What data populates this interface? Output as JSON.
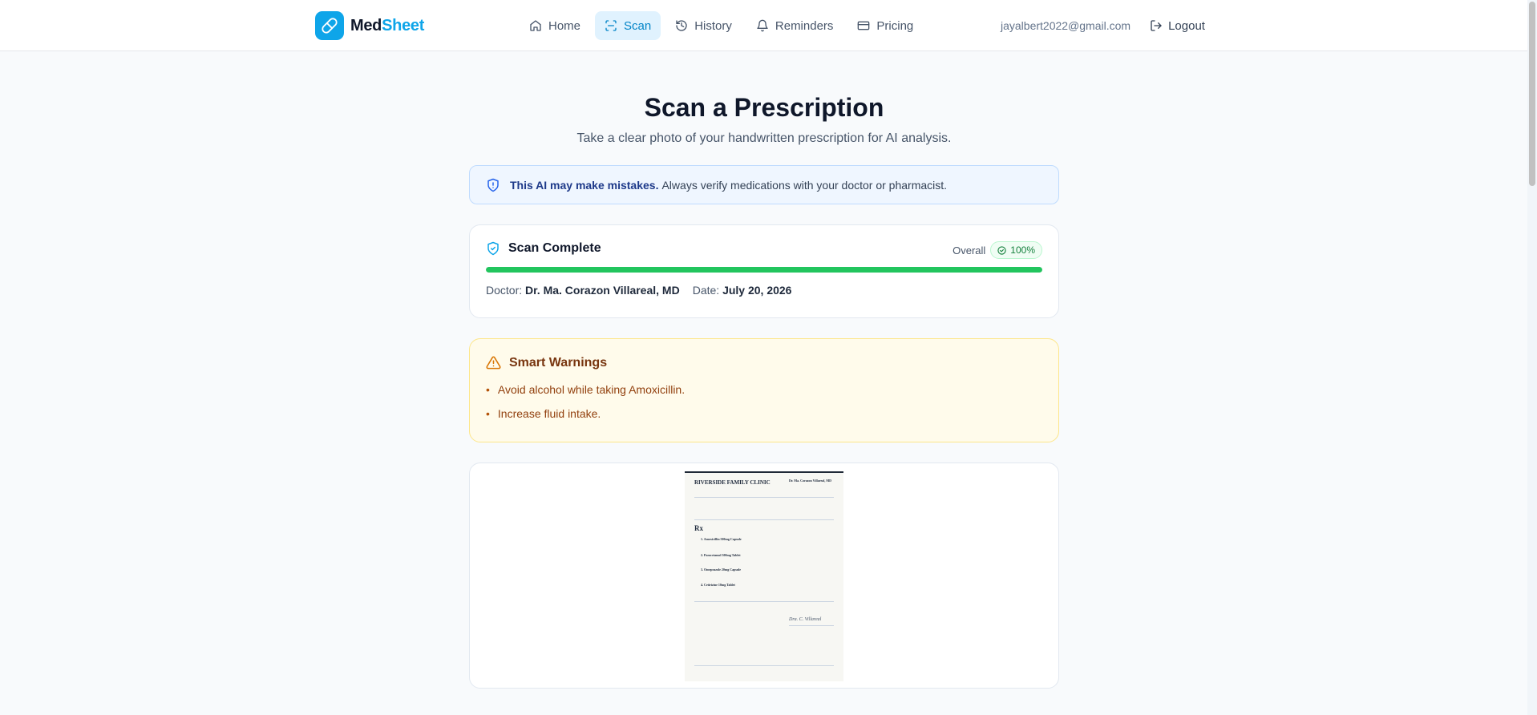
{
  "brand": {
    "name_part1": "Med",
    "name_part2": "Sheet",
    "accent": "#0ea5e9"
  },
  "nav": {
    "home": "Home",
    "scan": "Scan",
    "history": "History",
    "reminders": "Reminders",
    "pricing": "Pricing",
    "active": "Scan"
  },
  "user": {
    "email": "jayalbert2022@gmail.com",
    "logout_label": "Logout"
  },
  "page": {
    "title": "Scan a Prescription",
    "subtitle": "Take a clear photo of your handwritten prescription for AI analysis."
  },
  "notice": {
    "bold": "This AI may make mistakes.",
    "text": "Always verify medications with your doctor or pharmacist."
  },
  "scan_result": {
    "title": "Scan Complete",
    "overall_label": "Overall",
    "confidence": "100%",
    "progress_fraction": 1.0,
    "doctor_label": "Doctor:",
    "doctor": "Dr. Ma. Corazon Villareal, MD",
    "date_label": "Date:",
    "date": "July 20, 2026"
  },
  "warnings": {
    "title": "Smart Warnings",
    "items": [
      "Avoid alcohol while taking Amoxicillin.",
      "Increase fluid intake."
    ]
  },
  "prescription_image": {
    "clinic": "RIVERSIDE FAMILY CLINIC",
    "doctor": "Dr. Ma. Corazon Villareal, MD",
    "rx": "Rx",
    "meds": [
      "1. Amoxicillin 500mg Capsule",
      "2. Paracetamol 500mg Tablet",
      "3. Omeprazole 20mg Capsule",
      "4. Cetirizine 10mg Tablet"
    ],
    "signature": "Dra. C. Villareal"
  },
  "colors": {
    "success": "#22c55e",
    "warning_bg": "#fffbeb",
    "info_bg": "#eff6ff"
  }
}
